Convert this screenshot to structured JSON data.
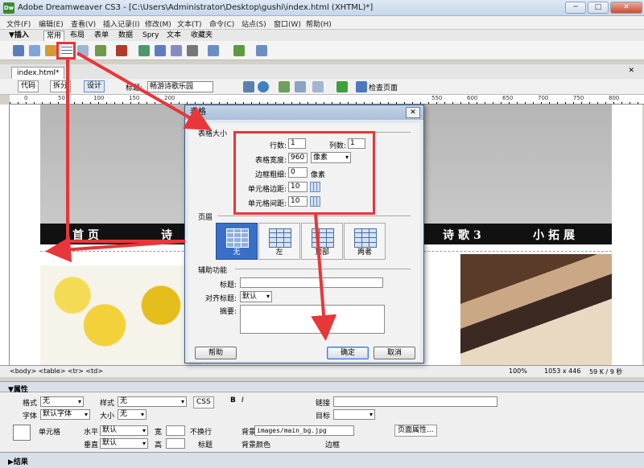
{
  "window": {
    "title": "Adobe Dreamweaver CS3 - [C:\\Users\\Administrator\\Desktop\\gushi\\index.html (XHTML)*]",
    "logo": "Dw",
    "min": "─",
    "max": "□",
    "close": "✕"
  },
  "menu": [
    "文件(F)",
    "编辑(E)",
    "查看(V)",
    "插入记录(I)",
    "修改(M)",
    "文本(T)",
    "命令(C)",
    "站点(S)",
    "窗口(W)",
    "帮助(H)"
  ],
  "insert_bar": {
    "toggle": "▼插入",
    "tabs": [
      "常用",
      "布局",
      "表单",
      "数据",
      "Spry",
      "文本",
      "收藏夹"
    ],
    "active_tab": "常用"
  },
  "document": {
    "tab": "index.html*",
    "close_doc": "✕",
    "view_buttons": [
      "代码",
      "拆分",
      "设计"
    ],
    "active_view": "设计",
    "title_label": "标题:",
    "title_value": "畅游诗歌乐园",
    "check_page": "检查页面"
  },
  "ruler_ticks": [
    "0",
    "50",
    "100",
    "150",
    "200",
    "250",
    "300",
    "350",
    "400",
    "450",
    "500",
    "550",
    "600",
    "650",
    "700",
    "750",
    "800",
    "850"
  ],
  "page": {
    "nav_items": [
      "首页",
      "诗",
      "诗歌3",
      "小拓展"
    ]
  },
  "status": {
    "tag_path": "<body> <table> <tr> <td>",
    "zoom": "100%",
    "size": "1053 x 446",
    "file": "59 K / 9 秒"
  },
  "properties": {
    "header": "▼属性",
    "format_label": "格式",
    "format_value": "无",
    "style_label": "样式",
    "style_value": "无",
    "css_button": "CSS",
    "bold": "B",
    "italic": "I",
    "link_label": "链接",
    "font_label": "字体",
    "font_value": "默认字体",
    "size_label": "大小",
    "size_value": "无",
    "target_label": "目标",
    "cell_label": "单元格",
    "horz_label": "水平",
    "horz_value": "默认",
    "vert_label": "垂直",
    "vert_value": "默认",
    "width_label": "宽",
    "height_label": "高",
    "nowrap_label": "不换行",
    "header_label": "标题",
    "bg_label": "背景",
    "bg_value": "images/main_bg.jpg",
    "bgcolor_label": "背景颜色",
    "border_label": "边框",
    "page_props_button": "页面属性...",
    "results": "▶结果"
  },
  "dialog": {
    "title": "表格",
    "close": "✕",
    "table_size_section": "表格大小",
    "rows_label": "行数:",
    "rows_value": "1",
    "cols_label": "列数:",
    "cols_value": "1",
    "width_label": "表格宽度:",
    "width_value": "960",
    "width_unit": "像素",
    "border_label": "边框粗细:",
    "border_value": "0",
    "border_unit": "像素",
    "padding_label": "单元格边距:",
    "padding_value": "10",
    "spacing_label": "单元格间距:",
    "spacing_value": "10",
    "header_section": "页眉",
    "header_options": [
      "无",
      "左",
      "顶部",
      "两者"
    ],
    "header_active": "无",
    "access_section": "辅助功能",
    "caption_label": "标题:",
    "caption_value": "",
    "align_caption_label": "对齐标题:",
    "align_caption_value": "默认",
    "summary_label": "摘要:",
    "help_button": "帮助",
    "ok_button": "确定",
    "cancel_button": "取消"
  },
  "annotation_color": "#e8363a"
}
